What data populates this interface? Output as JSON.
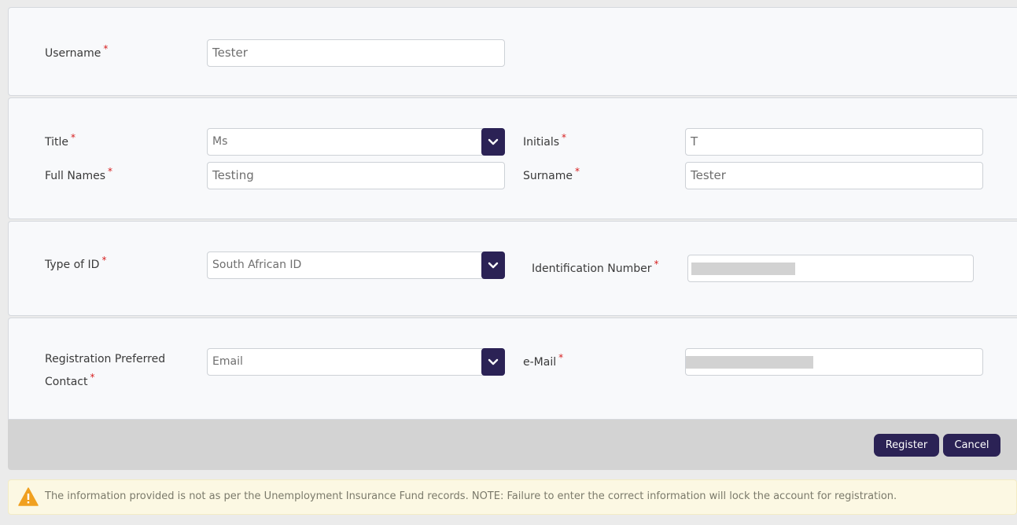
{
  "account": {
    "username_label": "Username",
    "username_value": "Tester"
  },
  "personal": {
    "title_label": "Title",
    "title_value": "Ms",
    "initials_label": "Initials",
    "initials_value": "T",
    "full_names_label": "Full Names",
    "full_names_value": "Testing",
    "surname_label": "Surname",
    "surname_value": "Tester"
  },
  "identity": {
    "type_label": "Type of ID",
    "type_value": "South African ID",
    "number_label": "Identification Number"
  },
  "contact": {
    "preferred_label_line1": "Registration Preferred",
    "preferred_label_line2": "Contact",
    "preferred_value": "Email",
    "email_label": "e-Mail"
  },
  "required_marker": "*",
  "actions": {
    "register_label": "Register",
    "cancel_label": "Cancel"
  },
  "notice": {
    "icon": "warning-icon",
    "text": "The information provided is not as per the Unemployment Insurance Fund records. NOTE: Failure to enter the correct information will lock the account for registration."
  },
  "colors": {
    "accent": "#2b2255",
    "required": "#d62020",
    "warning": "#f0a020",
    "notice_bg": "#fcf8e3"
  }
}
